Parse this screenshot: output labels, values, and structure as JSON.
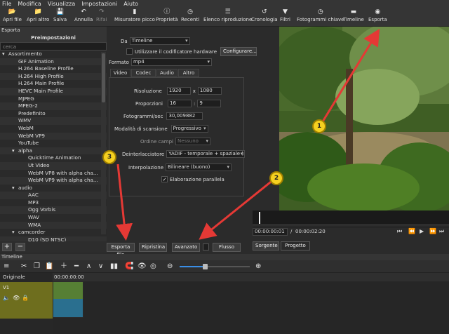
{
  "menu": [
    "File",
    "Modifica",
    "Visualizza",
    "Impostazioni",
    "Aiuto"
  ],
  "toolbar": [
    {
      "label": "Apri file",
      "icon": "folder-icon",
      "glyph": "📂"
    },
    {
      "label": "Apri altro",
      "icon": "folder-down-icon",
      "glyph": "📁"
    },
    {
      "label": "Salva",
      "icon": "save-icon",
      "glyph": "💾"
    },
    {
      "label": "Annulla",
      "icon": "undo-icon",
      "glyph": "↶"
    },
    {
      "label": "Rifai",
      "icon": "redo-icon",
      "glyph": "↷"
    },
    {
      "label": "Misuratore picco",
      "icon": "meter-icon",
      "glyph": "▮"
    },
    {
      "label": "Proprietà",
      "icon": "info-icon",
      "glyph": "ⓘ"
    },
    {
      "label": "Recenti",
      "icon": "clock-icon",
      "glyph": "◷"
    },
    {
      "label": "Elenco riproduzione",
      "icon": "list-icon",
      "glyph": "☰"
    },
    {
      "label": "Cronologia",
      "icon": "history-icon",
      "glyph": "↺"
    },
    {
      "label": "Filtri",
      "icon": "filter-icon",
      "glyph": "▼"
    },
    {
      "label": "Fotogrammi chiave",
      "icon": "keyframe-icon",
      "glyph": "◷"
    },
    {
      "label": "Timeline",
      "icon": "timeline-icon",
      "glyph": "▬"
    },
    {
      "label": "Esporta",
      "icon": "export-icon",
      "glyph": "◉"
    }
  ],
  "export_panel": {
    "title": "Esporta",
    "presets_header": "Preimpostazioni",
    "search_placeholder": "cerca",
    "tree": [
      {
        "label": "Assortimento",
        "indent": 0,
        "arrow": "▾"
      },
      {
        "label": "GIF Animation",
        "indent": 1,
        "arrow": ""
      },
      {
        "label": "H.264 Baseline Profile",
        "indent": 1,
        "arrow": ""
      },
      {
        "label": "H.264 High Profile",
        "indent": 1,
        "arrow": ""
      },
      {
        "label": "H.264 Main Profile",
        "indent": 1,
        "arrow": ""
      },
      {
        "label": "HEVC Main Profile",
        "indent": 1,
        "arrow": ""
      },
      {
        "label": "MJPEG",
        "indent": 1,
        "arrow": ""
      },
      {
        "label": "MPEG-2",
        "indent": 1,
        "arrow": ""
      },
      {
        "label": "Predefinito",
        "indent": 1,
        "arrow": ""
      },
      {
        "label": "WMV",
        "indent": 1,
        "arrow": ""
      },
      {
        "label": "WebM",
        "indent": 1,
        "arrow": ""
      },
      {
        "label": "WebM VP9",
        "indent": 1,
        "arrow": ""
      },
      {
        "label": "YouTube",
        "indent": 1,
        "arrow": ""
      },
      {
        "label": "alpha",
        "indent": 1,
        "arrow": "▾"
      },
      {
        "label": "Quicktime Animation",
        "indent": 2,
        "arrow": ""
      },
      {
        "label": "Ut Video",
        "indent": 2,
        "arrow": ""
      },
      {
        "label": "WebM VP8 with alpha cha...",
        "indent": 2,
        "arrow": ""
      },
      {
        "label": "WebM VP9 with alpha cha...",
        "indent": 2,
        "arrow": ""
      },
      {
        "label": "audio",
        "indent": 1,
        "arrow": "▾"
      },
      {
        "label": "AAC",
        "indent": 2,
        "arrow": ""
      },
      {
        "label": "MP3",
        "indent": 2,
        "arrow": ""
      },
      {
        "label": "Ogg Vorbis",
        "indent": 2,
        "arrow": ""
      },
      {
        "label": "WAV",
        "indent": 2,
        "arrow": ""
      },
      {
        "label": "WMA",
        "indent": 2,
        "arrow": ""
      },
      {
        "label": "camcorder",
        "indent": 1,
        "arrow": "▾"
      },
      {
        "label": "D10 (SD NTSC)",
        "indent": 2,
        "arrow": ""
      }
    ],
    "add_label": "+",
    "remove_label": "−",
    "da_label": "Da",
    "da_value": "Timeline",
    "hw_label": "Utilizzare il codificatore hardware",
    "configure_label": "Configurare...",
    "format_label": "Formato",
    "format_value": "mp4",
    "tabs": [
      "Video",
      "Codec",
      "Audio",
      "Altro"
    ],
    "resolution_label": "Risoluzione",
    "res_w": "1920",
    "res_x": "x",
    "res_h": "1080",
    "aspect_label": "Proporzioni",
    "aspect_w": "16",
    "aspect_sep": ":",
    "aspect_h": "9",
    "fps_label": "Fotogrammi/sec",
    "fps_value": "30,009882",
    "scan_label": "Modalità di scansione",
    "scan_value": "Progressivo",
    "field_label": "Ordine campi",
    "field_value": "Nessuno",
    "deint_label": "Deinterlacciatore",
    "deint_value": "YADIF - temporale + spaziale (m",
    "interp_label": "Interpolazione",
    "interp_value": "Bilineare (buono)",
    "parallel_label": "Elaborazione parallela",
    "parallel_check": "✓",
    "export_file_label": "Esporta file",
    "reset_label": "Ripristina",
    "advanced_label": "Avanzato",
    "stream_label": "Flusso"
  },
  "player": {
    "current_time": "00:00:00:01",
    "sep": "/",
    "total_time": "00:00:02:20",
    "source_tab": "Sorgente",
    "project_tab": "Progetto"
  },
  "timeline": {
    "title": "Timeline",
    "track_header": "Originale",
    "track_name": "V1",
    "ruler_time": "00:00:00:00"
  },
  "annotations": [
    "1",
    "2",
    "3"
  ],
  "colors": {
    "badge": "#f5d020",
    "arrow": "#e53935"
  }
}
